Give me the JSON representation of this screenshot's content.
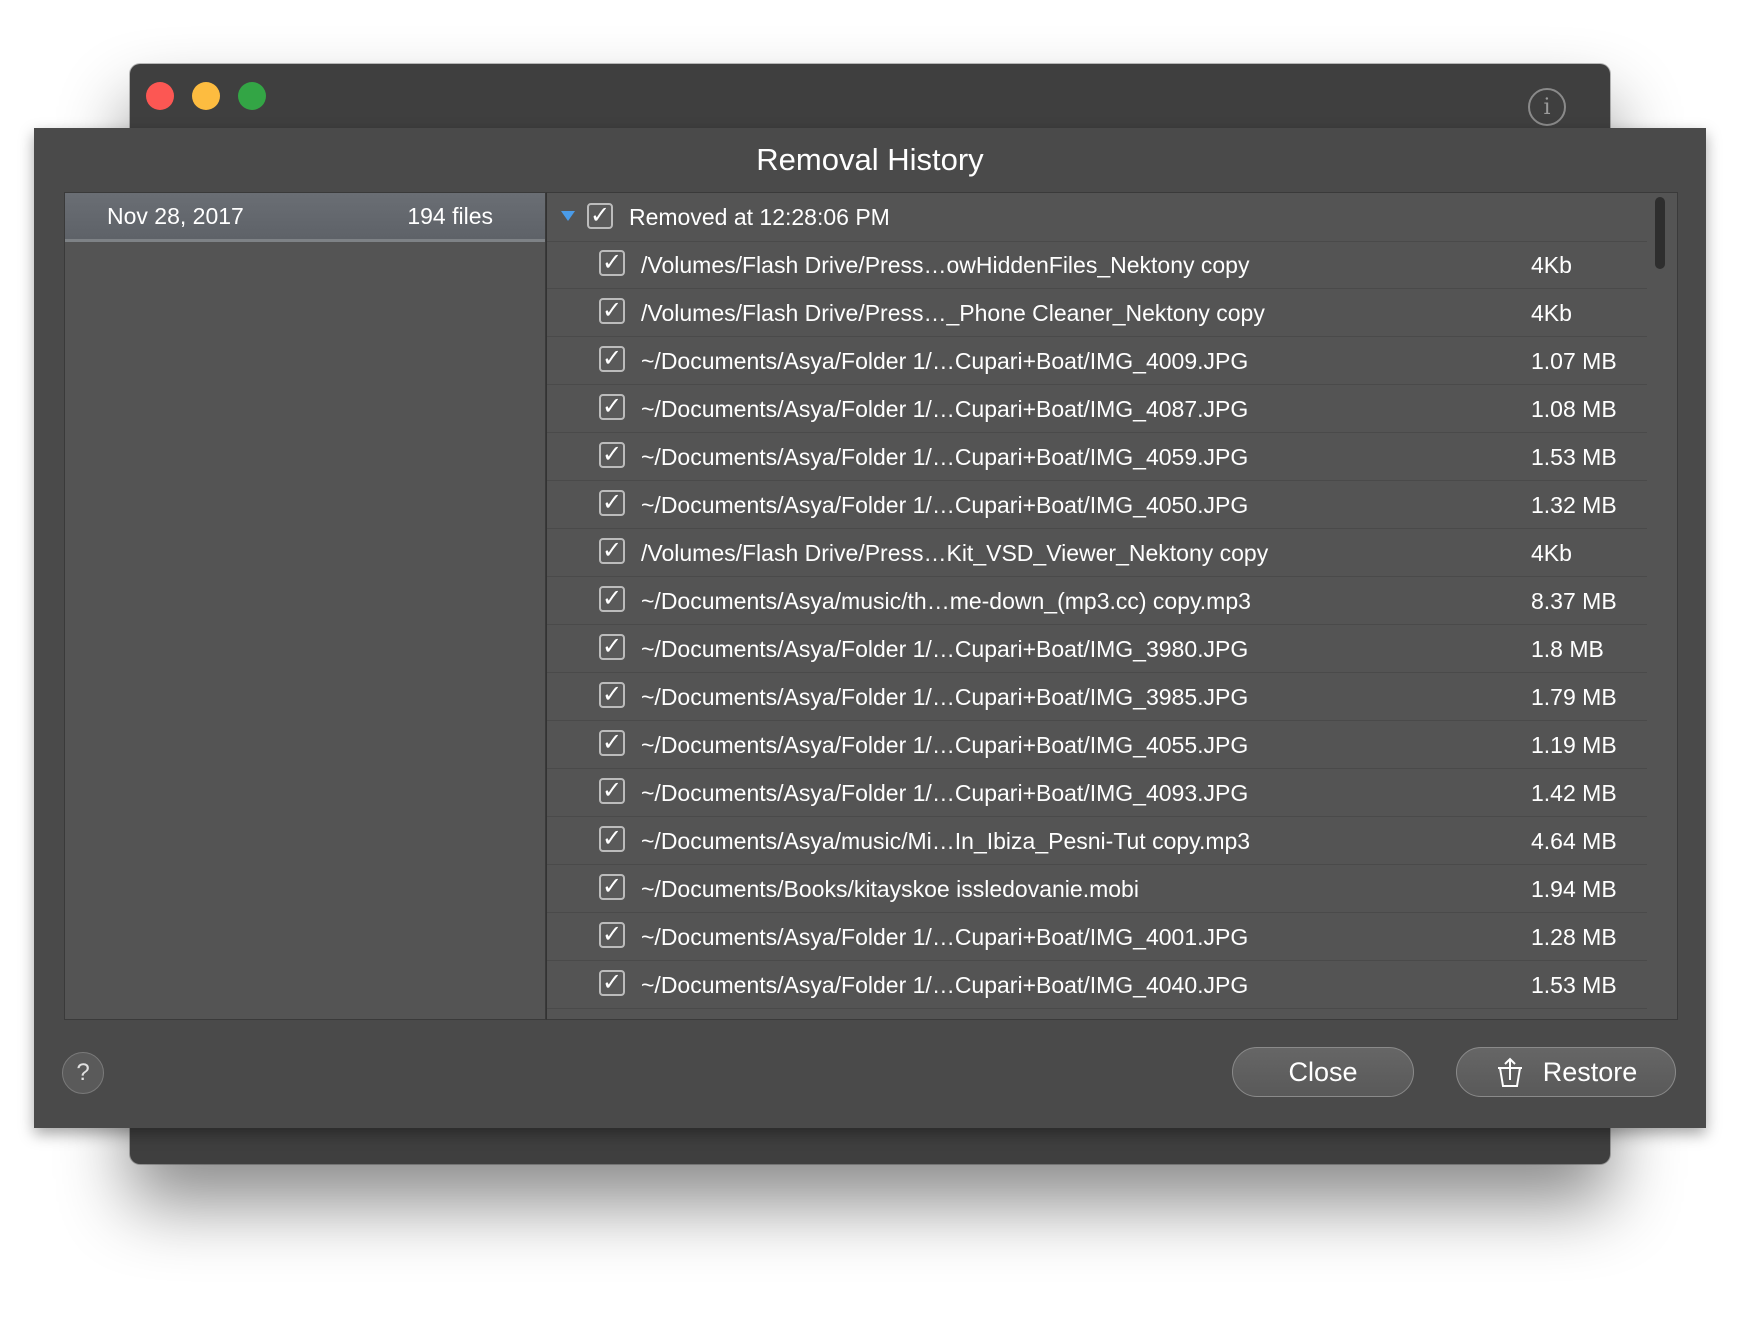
{
  "window": {
    "info_icon": "info-icon",
    "info_glyph": "i"
  },
  "sheet": {
    "title": "Removal History",
    "sessions": [
      {
        "date": "Nov 28, 2017",
        "count": "194 files"
      }
    ],
    "group": {
      "label": "Removed at 12:28:06 PM",
      "checked": true
    },
    "files": [
      {
        "path": "/Volumes/Flash Drive/Press…owHiddenFiles_Nektony copy",
        "size": "4Kb"
      },
      {
        "path": "/Volumes/Flash Drive/Press…_Phone Cleaner_Nektony copy",
        "size": "4Kb"
      },
      {
        "path": "~/Documents/Asya/Folder 1/…Cupari+Boat/IMG_4009.JPG",
        "size": "1.07 MB"
      },
      {
        "path": "~/Documents/Asya/Folder 1/…Cupari+Boat/IMG_4087.JPG",
        "size": "1.08 MB"
      },
      {
        "path": "~/Documents/Asya/Folder 1/…Cupari+Boat/IMG_4059.JPG",
        "size": "1.53 MB"
      },
      {
        "path": "~/Documents/Asya/Folder 1/…Cupari+Boat/IMG_4050.JPG",
        "size": "1.32 MB"
      },
      {
        "path": "/Volumes/Flash Drive/Press…Kit_VSD_Viewer_Nektony copy",
        "size": "4Kb"
      },
      {
        "path": "~/Documents/Asya/music/th…me-down_(mp3.cc) copy.mp3",
        "size": "8.37 MB"
      },
      {
        "path": "~/Documents/Asya/Folder 1/…Cupari+Boat/IMG_3980.JPG",
        "size": "1.8 MB"
      },
      {
        "path": "~/Documents/Asya/Folder 1/…Cupari+Boat/IMG_3985.JPG",
        "size": "1.79 MB"
      },
      {
        "path": "~/Documents/Asya/Folder 1/…Cupari+Boat/IMG_4055.JPG",
        "size": "1.19 MB"
      },
      {
        "path": "~/Documents/Asya/Folder 1/…Cupari+Boat/IMG_4093.JPG",
        "size": "1.42 MB"
      },
      {
        "path": "~/Documents/Asya/music/Mi…In_Ibiza_Pesni-Tut copy.mp3",
        "size": "4.64 MB"
      },
      {
        "path": "~/Documents/Books/kitayskoe issledovanie.mobi",
        "size": "1.94 MB"
      },
      {
        "path": "~/Documents/Asya/Folder 1/…Cupari+Boat/IMG_4001.JPG",
        "size": "1.28 MB"
      },
      {
        "path": "~/Documents/Asya/Folder 1/…Cupari+Boat/IMG_4040.JPG",
        "size": "1.53 MB"
      }
    ],
    "check_glyph": "✓",
    "help_glyph": "?",
    "close_label": "Close",
    "restore_label": "Restore"
  },
  "colors": {
    "close": "#fc5753",
    "minimize": "#fdbc40",
    "maximize": "#33a545",
    "disclosure": "#4a9be8",
    "sheet_bg": "#4a4a4a",
    "pane_bg": "#545454"
  }
}
